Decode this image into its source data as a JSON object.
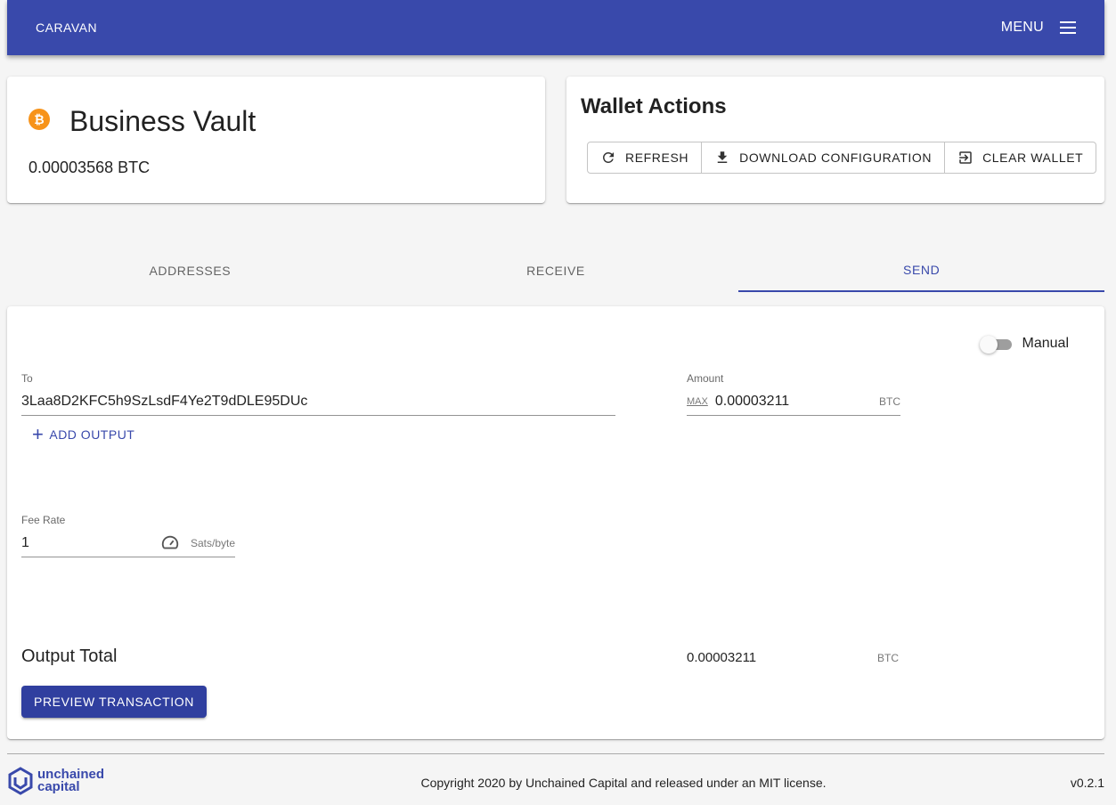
{
  "appbar": {
    "brand": "CARAVAN",
    "menu_label": "MENU"
  },
  "vault": {
    "name": "Business Vault",
    "balance": "0.00003568 BTC",
    "currency_symbol": "₿"
  },
  "wallet_actions": {
    "title": "Wallet Actions",
    "buttons": [
      {
        "label": "REFRESH",
        "icon": "refresh-icon"
      },
      {
        "label": "DOWNLOAD CONFIGURATION",
        "icon": "download-icon"
      },
      {
        "label": "CLEAR WALLET",
        "icon": "exit-icon"
      }
    ]
  },
  "tabs": [
    {
      "label": "ADDRESSES",
      "active": false
    },
    {
      "label": "RECEIVE",
      "active": false
    },
    {
      "label": "SEND",
      "active": true
    }
  ],
  "send": {
    "manual_label": "Manual",
    "manual_on": false,
    "to_label": "To",
    "to_value": "3Laa8D2KFC5h9SzLsdF4Ye2T9dDLE95DUc",
    "amount_label": "Amount",
    "amount_max": "MAX",
    "amount_value": "0.00003211",
    "amount_unit": "BTC",
    "add_output": "ADD OUTPUT",
    "fee_label": "Fee Rate",
    "fee_value": "1",
    "fee_unit": "Sats/byte",
    "output_total_label": "Output Total",
    "output_total_value": "0.00003211",
    "output_total_unit": "BTC",
    "preview_button": "PREVIEW TRANSACTION"
  },
  "footer": {
    "logo_line1": "unchained",
    "logo_line2": "capital",
    "copyright": "Copyright 2020 by Unchained Capital and released under an MIT license.",
    "version": "v0.2.1"
  },
  "colors": {
    "primary": "#3949ab",
    "primary_dark": "#303f9f",
    "bitcoin": "#f7931a"
  }
}
